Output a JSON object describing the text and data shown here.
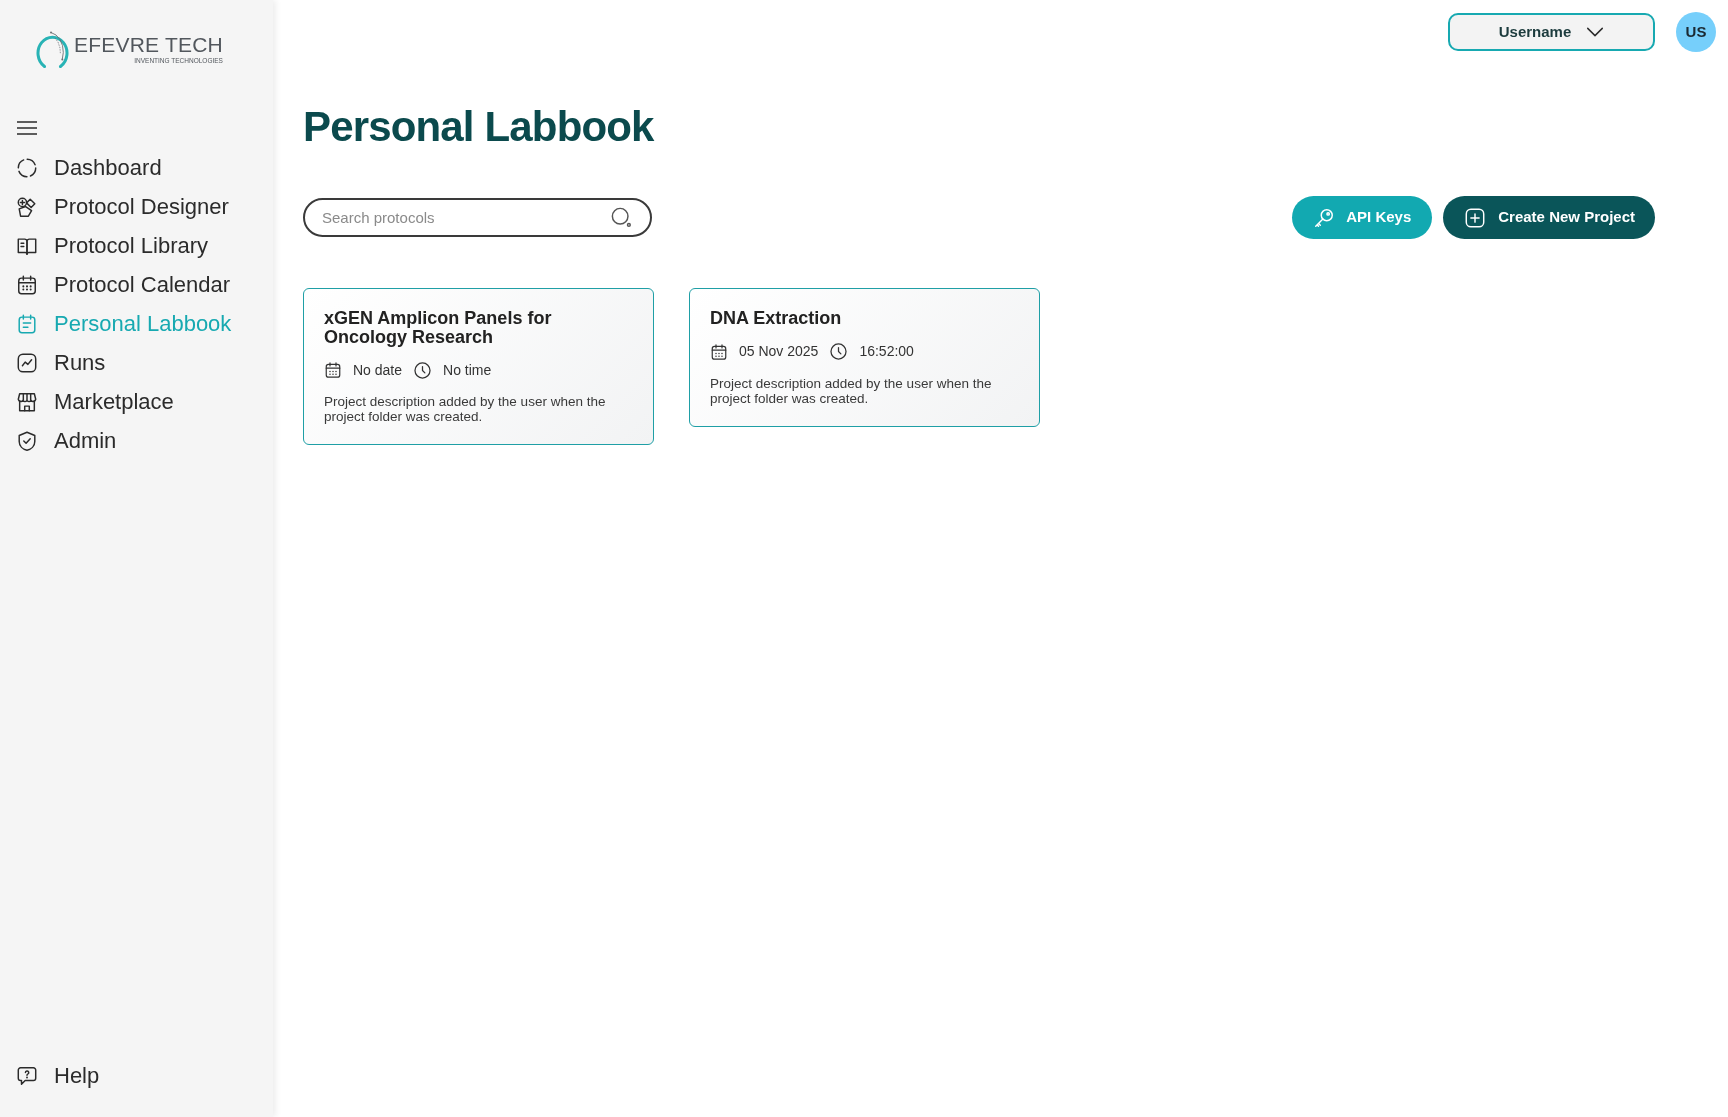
{
  "sidebar": {
    "logo": {
      "name": "EFEVRE TECH",
      "tagline": "INVENTING TECHNOLOGIES"
    },
    "items": [
      {
        "label": "Dashboard",
        "selected": false
      },
      {
        "label": "Protocol Designer",
        "selected": false
      },
      {
        "label": "Protocol Library",
        "selected": false
      },
      {
        "label": "Protocol Calendar",
        "selected": false
      },
      {
        "label": "Personal Labbook",
        "selected": true
      },
      {
        "label": "Runs",
        "selected": false
      },
      {
        "label": "Marketplace",
        "selected": false
      },
      {
        "label": "Admin",
        "selected": false
      }
    ],
    "footer_items": [
      {
        "label": "Help",
        "selected": false
      }
    ]
  },
  "header": {
    "user_menu": {
      "label": "Username"
    },
    "avatar": {
      "initials": "US"
    }
  },
  "page": {
    "title": "Personal Labbook",
    "search": {
      "placeholder": "Search protocols"
    },
    "actions": [
      {
        "label": "API Keys",
        "kind": "secondary"
      },
      {
        "label": "Create New Project",
        "kind": "primary"
      }
    ]
  },
  "projects": [
    {
      "title": "xGEN Amplicon Panels for Oncology Research",
      "date": "No date",
      "time": "No time",
      "description": "Project description added by the user when the project folder was created."
    },
    {
      "title": "DNA Extraction",
      "date": "05 Nov 2025",
      "time": "16:52:00",
      "description": "Project description added by the user when the project folder was created."
    }
  ]
}
